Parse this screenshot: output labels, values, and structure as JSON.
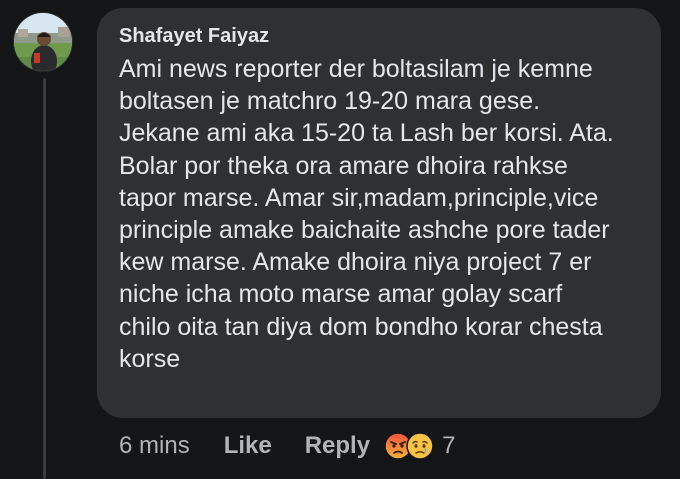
{
  "comment": {
    "author": "Shafayet Faiyaz",
    "lines": [
      "Ami news reporter der boltasilam je kemne",
      "boltasen je matchro 19-20 mara gese.",
      "Jekane ami aka 15-20 ta Lash ber korsi. Ata.",
      "Bolar por theka ora amare dhoira rahkse",
      "tapor marse. Amar sir,madam,principle,vice",
      "principle amake baichaite ashche pore tader",
      "kew marse. Amake dhoira niya project 7 er",
      "niche icha moto marse amar golay scarf",
      "chilo oita tan diya dom bondho korar chesta",
      "korse"
    ]
  },
  "meta": {
    "timestamp": "6 mins",
    "like_label": "Like",
    "reply_label": "Reply",
    "reactions": [
      "angry-emoji-icon",
      "sad-emoji-icon"
    ],
    "reaction_count": "7"
  },
  "colors": {
    "background": "#141516",
    "bubble": "#2f3032",
    "primary_text": "#e4e6eb",
    "secondary_text": "#b0b3b8"
  }
}
